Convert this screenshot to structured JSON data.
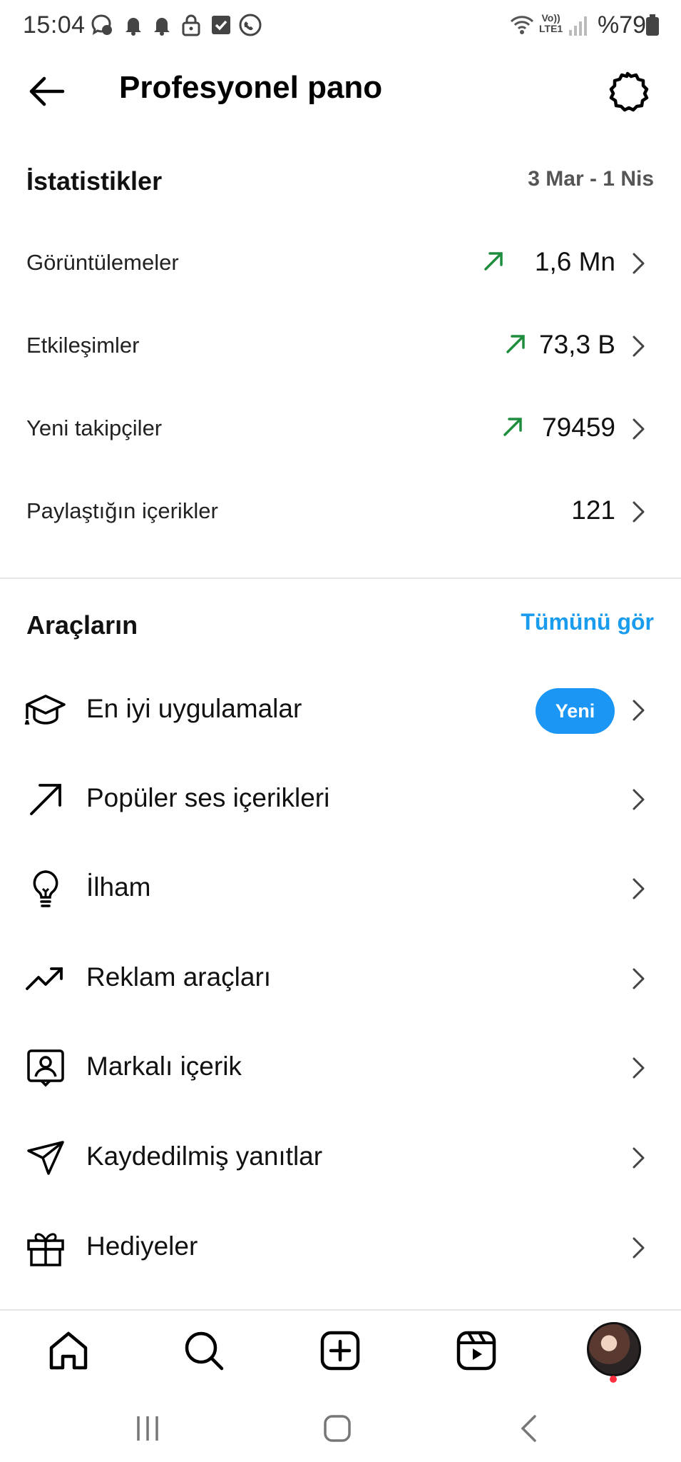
{
  "status_bar": {
    "time": "15:04",
    "battery_text": "%79",
    "icons": [
      "messenger-icon",
      "bell-icon",
      "bell-icon",
      "lock-icon",
      "checkbox-icon",
      "phone-circle-icon",
      "wifi-icon",
      "volte-icon",
      "signal-icon",
      "battery-icon"
    ],
    "volte_top": "Vo))",
    "volte_bottom": "LTE1"
  },
  "header": {
    "title": "Profesyonel pano"
  },
  "statistics": {
    "heading": "İstatistikler",
    "date_range": "3 Mar - 1 Nis",
    "trend_color": "#1e8e3e",
    "rows": [
      {
        "label": "Görüntülemeler",
        "value": "1,6 Mn",
        "trend": "up"
      },
      {
        "label": "Etkileşimler",
        "value": "73,3 B",
        "trend": "up"
      },
      {
        "label": "Yeni takipçiler",
        "value": "79459",
        "trend": "up"
      },
      {
        "label": "Paylaştığın içerikler",
        "value": "121",
        "trend": "none"
      }
    ]
  },
  "tools": {
    "heading": "Araçların",
    "see_all": "Tümünü gör",
    "accent": "#1a9cee",
    "items": [
      {
        "label": "En iyi uygulamalar",
        "icon": "graduation-cap-icon",
        "badge": "Yeni"
      },
      {
        "label": "Popüler ses içerikleri",
        "icon": "arrow-up-right-icon"
      },
      {
        "label": "İlham",
        "icon": "lightbulb-icon"
      },
      {
        "label": "Reklam araçları",
        "icon": "trending-up-icon"
      },
      {
        "label": "Markalı içerik",
        "icon": "branded-content-icon"
      },
      {
        "label": "Kaydedilmiş yanıtlar",
        "icon": "paper-plane-icon"
      },
      {
        "label": "Hediyeler",
        "icon": "gift-icon"
      }
    ]
  },
  "bottom_nav": {
    "items": [
      "home-icon",
      "search-icon",
      "create-icon",
      "reels-icon",
      "profile-avatar"
    ]
  },
  "system_nav": {
    "items": [
      "recent-apps-icon",
      "home-circle-icon",
      "back-chevron-icon"
    ]
  }
}
